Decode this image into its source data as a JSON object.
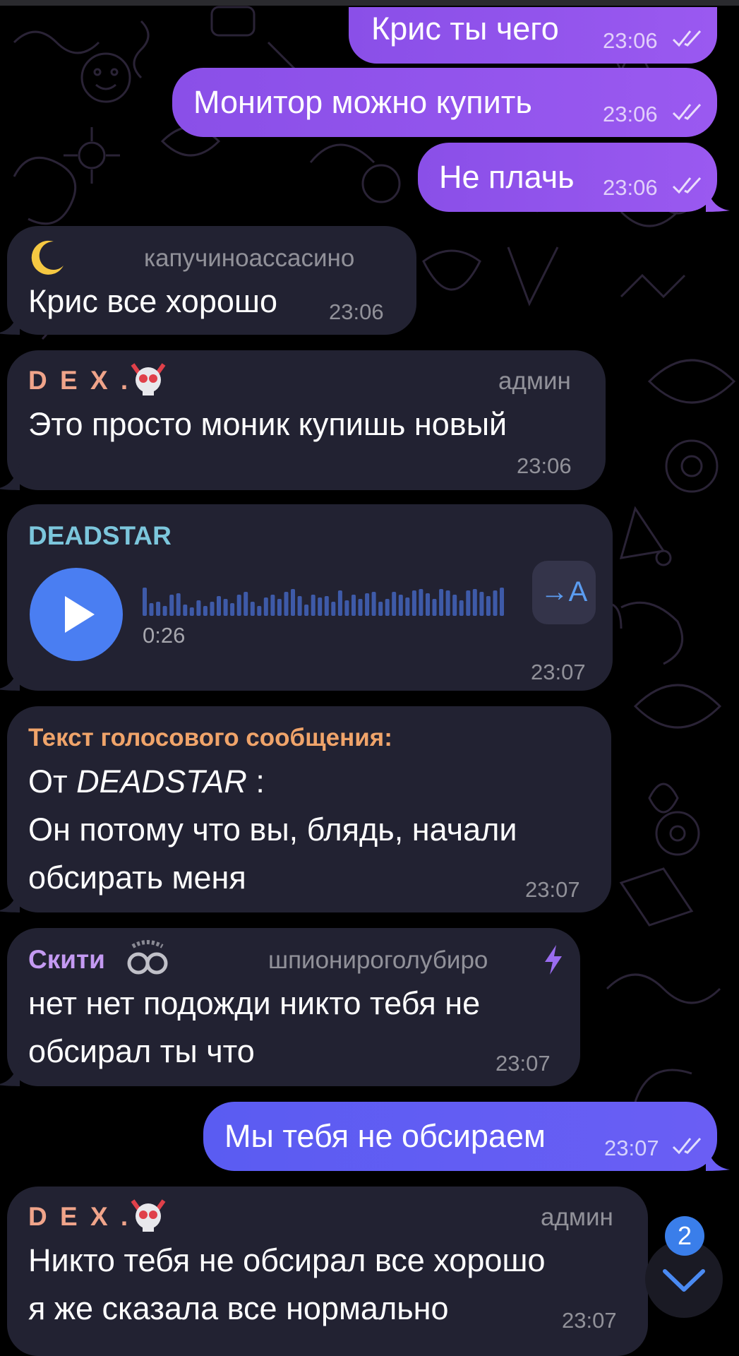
{
  "messages": [
    {
      "type": "outgoing",
      "text": "Крис ты чего",
      "time": "23:06"
    },
    {
      "type": "outgoing",
      "text": "Монитор можно купить",
      "time": "23:06"
    },
    {
      "type": "outgoing",
      "text": "Не плачь",
      "time": "23:06"
    },
    {
      "type": "incoming",
      "sender_emoji": "moon-emoji",
      "sender_role": "капучиноассасино",
      "text": "Крис все хорошо",
      "time": "23:06"
    },
    {
      "type": "incoming",
      "sender": "D E X .",
      "sender_color": "#f0a48a",
      "sender_role": "админ",
      "text": "Это просто моник купишь новый",
      "time": "23:06"
    },
    {
      "type": "voice",
      "sender": "DEADSTAR",
      "sender_color": "#7cc6dc",
      "duration": "0:26",
      "transcribe_label": "→A",
      "time": "23:07"
    },
    {
      "type": "incoming",
      "title": "Текст голосового сообщения:",
      "title_color": "#f0a46a",
      "from_prefix": "От ",
      "from_name": "DEADSTAR",
      "from_suffix": " :",
      "line1": "Он потому что вы, блядь, начали",
      "line2": "обсирать меня",
      "time": "23:07"
    },
    {
      "type": "incoming",
      "sender": "Скити",
      "sender_color": "#c49af2",
      "sender_role": "шпионироголубиро",
      "line1": "нет нет подожди никто тебя не",
      "line2": "обсирал ты что",
      "time": "23:07"
    },
    {
      "type": "outgoing",
      "text": "Мы тебя не обсираем",
      "time": "23:07"
    },
    {
      "type": "incoming",
      "sender": "D E X .",
      "sender_color": "#f0a48a",
      "sender_role": "админ",
      "line1": "Никто тебя не обсирал все хорошо",
      "line2": "я же сказала все нормально",
      "time": "23:07"
    }
  ],
  "scroll_down": {
    "unread_count": "2",
    "icon": "chevron-down-icon"
  },
  "colors": {
    "outgoing": "#9157ee",
    "outgoing_alt": "#5f5df3",
    "incoming": "#222232",
    "background": "#000000",
    "accent": "#4a7ef2"
  }
}
